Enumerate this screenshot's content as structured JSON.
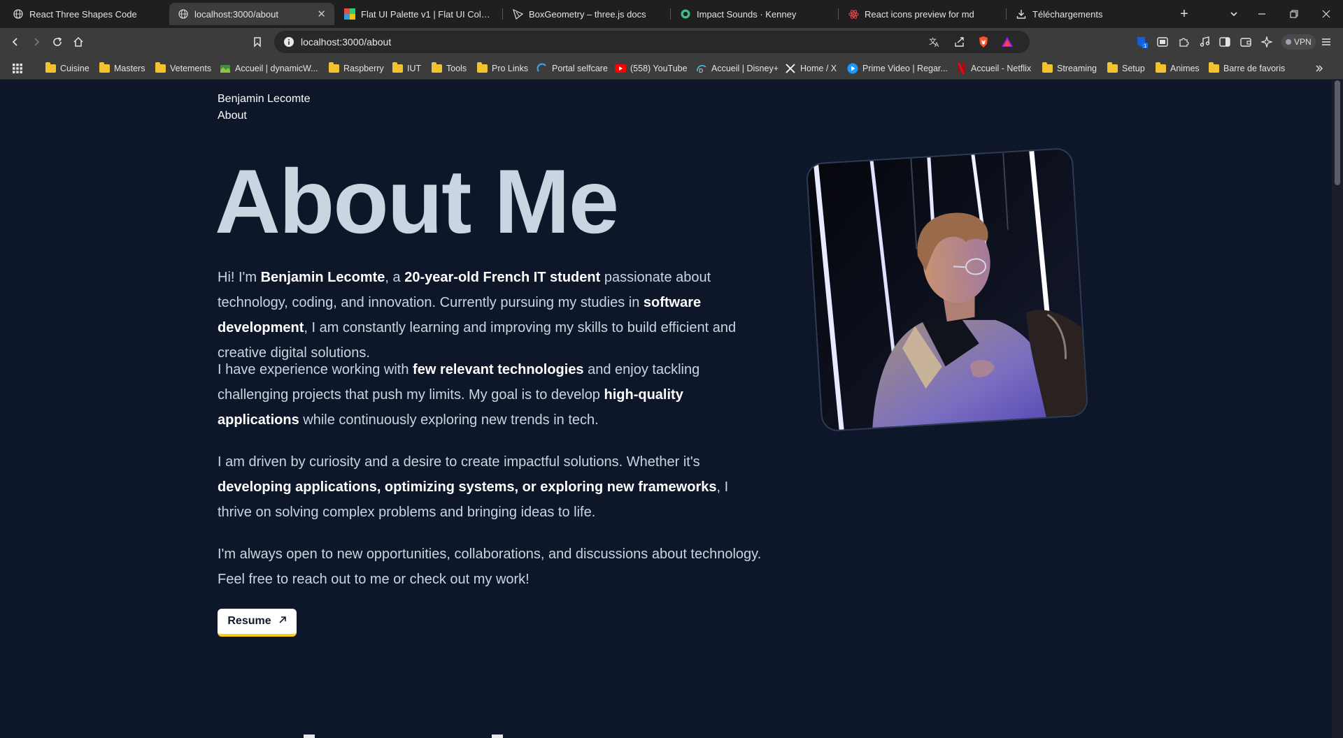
{
  "browser": {
    "tabs": [
      {
        "title": "React Three Shapes Code",
        "active": false
      },
      {
        "title": "localhost:3000/about",
        "active": true
      },
      {
        "title": "Flat UI Palette v1 | Flat UI Colors",
        "active": false
      },
      {
        "title": "BoxGeometry – three.js docs",
        "active": false
      },
      {
        "title": "Impact Sounds · Kenney",
        "active": false
      },
      {
        "title": "React icons preview for md",
        "active": false
      },
      {
        "title": "Téléchargements",
        "active": false
      }
    ],
    "url": "localhost:3000/about",
    "vpn_label": "VPN",
    "extension_badge": "1",
    "bookmarks": [
      {
        "label": "Cuisine",
        "icon": "folder-icon"
      },
      {
        "label": "Masters",
        "icon": "folder-icon"
      },
      {
        "label": "Vetements",
        "icon": "folder-icon"
      },
      {
        "label": "Accueil | dynamicW...",
        "icon": "site-icon"
      },
      {
        "label": "Raspberry",
        "icon": "folder-icon"
      },
      {
        "label": "IUT",
        "icon": "folder-icon"
      },
      {
        "label": "Tools",
        "icon": "folder-icon"
      },
      {
        "label": "Pro Links",
        "icon": "folder-icon"
      },
      {
        "label": "Portal selfcare",
        "icon": "site-icon"
      },
      {
        "label": "(558) YouTube",
        "icon": "youtube-icon"
      },
      {
        "label": "Accueil | Disney+",
        "icon": "disney-icon"
      },
      {
        "label": "Home / X",
        "icon": "x-icon"
      },
      {
        "label": "Prime Video | Regar...",
        "icon": "prime-icon"
      },
      {
        "label": "Accueil - Netflix",
        "icon": "netflix-icon"
      },
      {
        "label": "Streaming",
        "icon": "folder-icon"
      },
      {
        "label": "Setup",
        "icon": "folder-icon"
      },
      {
        "label": "Animes",
        "icon": "folder-icon"
      },
      {
        "label": "Barre de favoris",
        "icon": "folder-icon"
      }
    ]
  },
  "site": {
    "name": "Benjamin Lecomte",
    "nav_about": "About"
  },
  "about": {
    "title": "About Me",
    "p1": {
      "t1": "Hi! I'm ",
      "b1": "Benjamin Lecomte",
      "t2": ", a ",
      "b2": "20-year-old French IT student",
      "t3": " passionate about technology, coding, and innovation. Currently pursuing my studies in ",
      "b3": "software development",
      "t4": ", I am constantly learning and improving my skills to build efficient and creative digital solutions."
    },
    "p2": {
      "t1": "I have experience working with ",
      "b1": "few relevant technologies",
      "t2": " and enjoy tackling challenging projects that push my limits. My goal is to develop ",
      "b2": "high-quality applications",
      "t3": " while continuously exploring new trends in tech."
    },
    "p3": {
      "t1": "I am driven by curiosity and a desire to create impactful solutions. Whether it's ",
      "b1": "developing applications, optimizing systems, or exploring new frameworks",
      "t2": ", I thrive on solving complex problems and bringing ideas to life."
    },
    "p4": "I'm always open to new opportunities, collaborations, and discussions about technology. Feel free to reach out to me or check out my work!",
    "resume_label": "Resume"
  },
  "colors": {
    "page_bg": "#0e1629",
    "title": "#cbd5e1",
    "accent_underline": "#facc15"
  }
}
